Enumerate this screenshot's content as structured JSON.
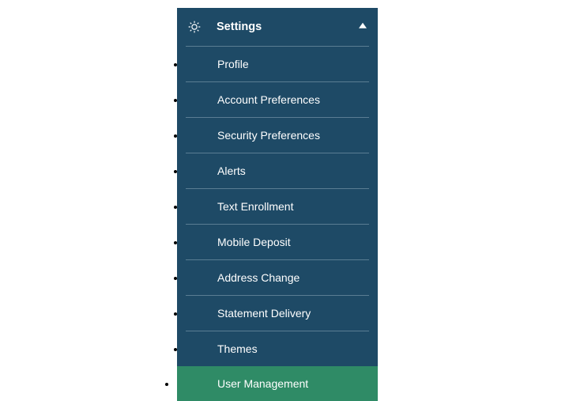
{
  "menu": {
    "title": "Settings",
    "expanded": true,
    "items": [
      {
        "label": "Profile",
        "active": false
      },
      {
        "label": "Account Preferences",
        "active": false
      },
      {
        "label": "Security Preferences",
        "active": false
      },
      {
        "label": "Alerts",
        "active": false
      },
      {
        "label": "Text Enrollment",
        "active": false
      },
      {
        "label": "Mobile Deposit",
        "active": false
      },
      {
        "label": "Address Change",
        "active": false
      },
      {
        "label": "Statement Delivery",
        "active": false
      },
      {
        "label": "Themes",
        "active": false
      },
      {
        "label": "User Management",
        "active": true
      }
    ]
  }
}
